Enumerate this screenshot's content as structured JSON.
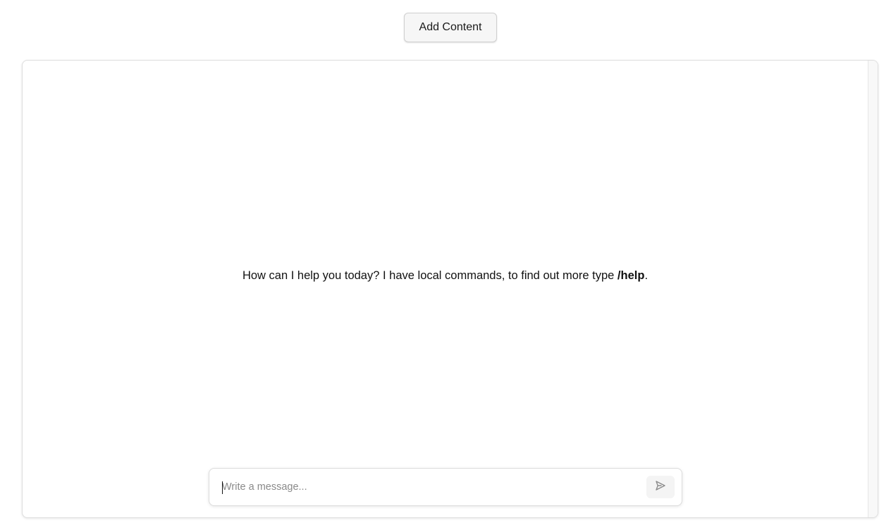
{
  "toolbar": {
    "add_content_label": "Add Content"
  },
  "chat": {
    "welcome_prefix": "How can I help you today? I have local commands, to find out more type ",
    "welcome_command": "/help",
    "welcome_suffix": "."
  },
  "composer": {
    "placeholder": "Write a message...",
    "value": "",
    "send_icon": "send-icon"
  },
  "colors": {
    "panel_border": "#dedede",
    "button_bg": "#f6f6f6",
    "send_icon": "#8a8a8a"
  }
}
